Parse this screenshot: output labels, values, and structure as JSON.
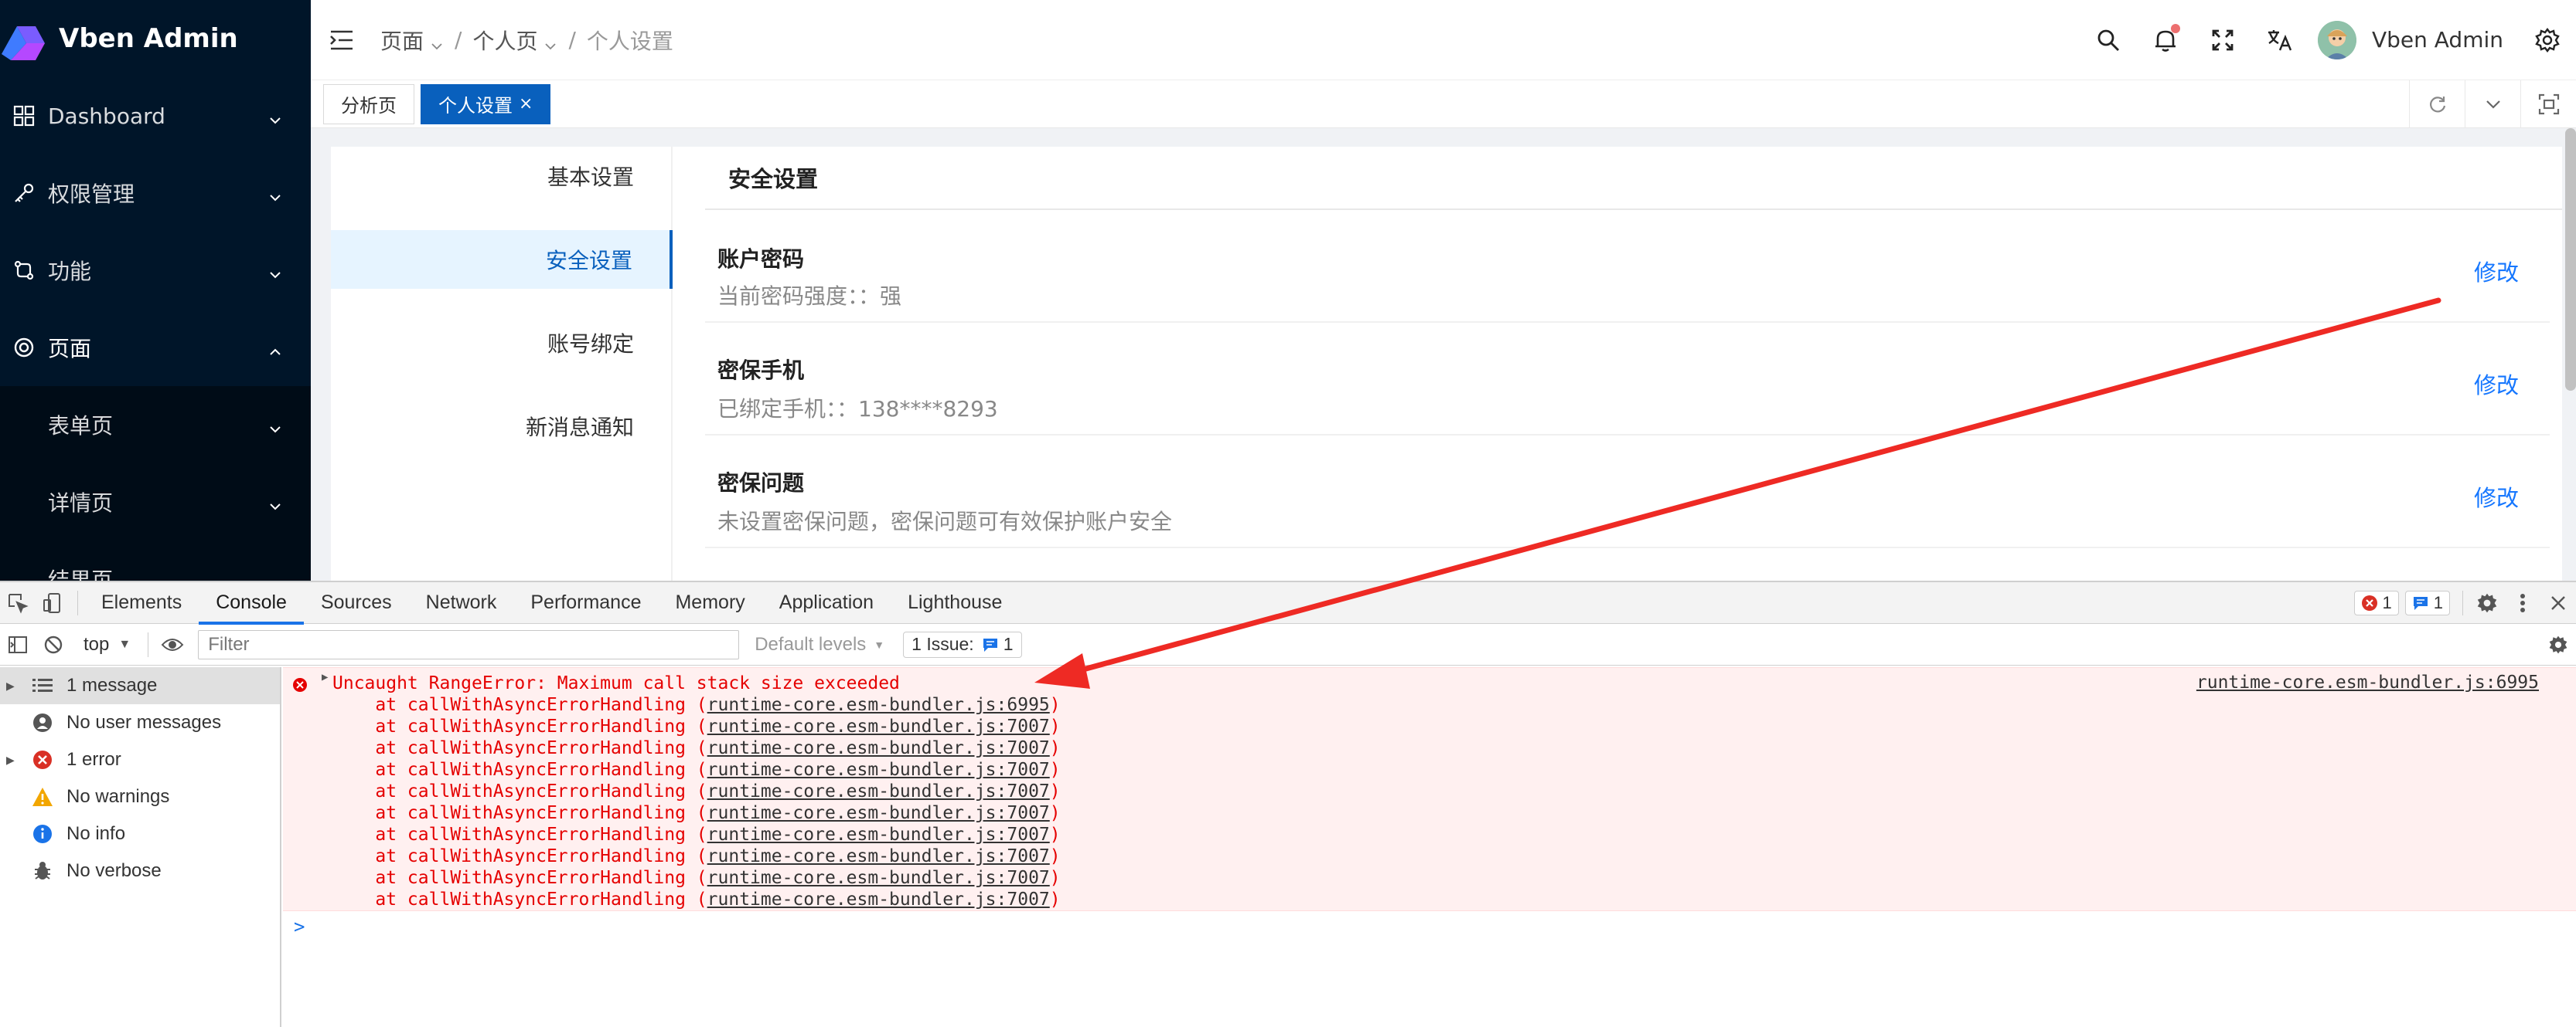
{
  "app": {
    "logo_title": "Vben Admin",
    "sidebar": {
      "items": [
        {
          "label": "Dashboard",
          "icon": "dashboard-icon"
        },
        {
          "label": "权限管理",
          "icon": "key-icon"
        },
        {
          "label": "功能",
          "icon": "function-icon"
        },
        {
          "label": "页面",
          "icon": "page-icon"
        }
      ],
      "submenu": [
        {
          "label": "表单页"
        },
        {
          "label": "详情页"
        },
        {
          "label": "结果页"
        }
      ]
    },
    "breadcrumb": [
      "页面",
      "个人页",
      "个人设置"
    ],
    "user_name": "Vben Admin",
    "tabs": [
      {
        "label": "分析页"
      },
      {
        "label": "个人设置",
        "close": "×"
      }
    ],
    "settings_nav": [
      "基本设置",
      "安全设置",
      "账号绑定",
      "新消息通知"
    ],
    "pane_title": "安全设置",
    "security_items": [
      {
        "title": "账户密码",
        "desc": "当前密码强度：：强",
        "action": "修改"
      },
      {
        "title": "密保手机",
        "desc": "已绑定手机：：138****8293",
        "action": "修改"
      },
      {
        "title": "密保问题",
        "desc": "未设置密保问题，密保问题可有效保护账户安全",
        "action": "修改"
      }
    ],
    "colors": {
      "sidebar_bg": "#001529",
      "primary": "#0960bd",
      "link": "#1677ff"
    }
  },
  "devtools": {
    "tabs": [
      "Elements",
      "Console",
      "Sources",
      "Network",
      "Performance",
      "Memory",
      "Application",
      "Lighthouse"
    ],
    "error_count": "1",
    "message_count": "1",
    "context": "top",
    "filter_placeholder": "Filter",
    "levels": "Default levels",
    "issues_label": "1 Issue:",
    "issues_count": "1",
    "sidebar": [
      {
        "label": "1 message",
        "expandable": true,
        "icon": "list-icon"
      },
      {
        "label": "No user messages",
        "icon": "user-icon"
      },
      {
        "label": "1 error",
        "expandable": true,
        "icon": "error-icon"
      },
      {
        "label": "No warnings",
        "icon": "warning-icon"
      },
      {
        "label": "No info",
        "icon": "info-icon"
      },
      {
        "label": "No verbose",
        "icon": "bug-icon"
      }
    ],
    "error": {
      "message": "Uncaught RangeError: Maximum call stack size exceeded",
      "source": "runtime-core.esm-bundler.js:6995",
      "stack": [
        {
          "prefix": "    at callWithAsyncErrorHandling (",
          "link": "runtime-core.esm-bundler.js:6995",
          "suffix": ")"
        },
        {
          "prefix": "    at callWithAsyncErrorHandling (",
          "link": "runtime-core.esm-bundler.js:7007",
          "suffix": ")"
        },
        {
          "prefix": "    at callWithAsyncErrorHandling (",
          "link": "runtime-core.esm-bundler.js:7007",
          "suffix": ")"
        },
        {
          "prefix": "    at callWithAsyncErrorHandling (",
          "link": "runtime-core.esm-bundler.js:7007",
          "suffix": ")"
        },
        {
          "prefix": "    at callWithAsyncErrorHandling (",
          "link": "runtime-core.esm-bundler.js:7007",
          "suffix": ")"
        },
        {
          "prefix": "    at callWithAsyncErrorHandling (",
          "link": "runtime-core.esm-bundler.js:7007",
          "suffix": ")"
        },
        {
          "prefix": "    at callWithAsyncErrorHandling (",
          "link": "runtime-core.esm-bundler.js:7007",
          "suffix": ")"
        },
        {
          "prefix": "    at callWithAsyncErrorHandling (",
          "link": "runtime-core.esm-bundler.js:7007",
          "suffix": ")"
        },
        {
          "prefix": "    at callWithAsyncErrorHandling (",
          "link": "runtime-core.esm-bundler.js:7007",
          "suffix": ")"
        },
        {
          "prefix": "    at callWithAsyncErrorHandling (",
          "link": "runtime-core.esm-bundler.js:7007",
          "suffix": ")"
        }
      ]
    },
    "prompt": ">",
    "colors": {
      "error_text": "#e50000",
      "error_bg": "#fff0f0",
      "accent": "#1a73e8"
    }
  },
  "annotation": {
    "color": "#ee2a24"
  }
}
